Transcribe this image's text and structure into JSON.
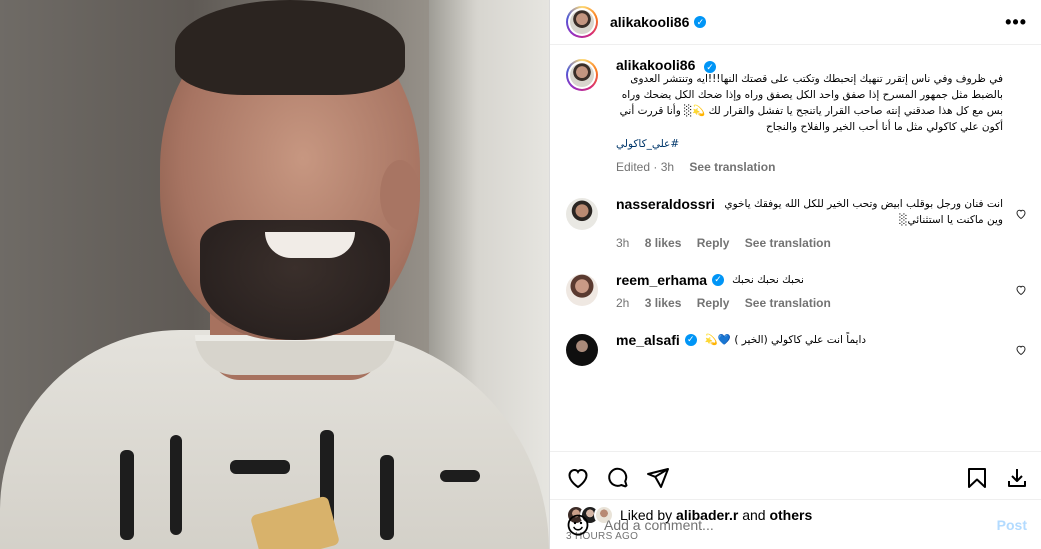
{
  "post": {
    "author": "alikakooli86",
    "more_icon": "•••"
  },
  "caption": {
    "author": "alikakooli86",
    "text": "في ظروف وفي ناس إتقرر تنهيك إتحبطك وتكتب على قصتك النها!!!ايه وتنتشر العدوى بالضبط مثل جمهور المسرح إذا صفق واحد الكل يصفق وراه وإذا ضحك الكل يضحك وراه بس مع كل هذا صدقني إنته صاحب القرار ياتنجح يا تفشل والقرار لك 💫░ وأنا قررت أني أكون علي كاكولي مثل ما أنا أحب الخير والفلاح والنجاح",
    "hashtag": "#علي_كاكولي",
    "edited": "Edited · 3h",
    "translate": "See translation"
  },
  "comments": [
    {
      "user": "nasseraldossri",
      "text": "انت فنان ورجل بوقلب ابيض وتحب الخير للكل الله يوفقك ياخوي وين ماكنت يا استثنائي░",
      "time": "3h",
      "likes": "8 likes",
      "reply": "Reply",
      "translate": "See translation"
    },
    {
      "user": "reem_erhama",
      "text": "نحبك نحبك نحبك",
      "time": "2h",
      "likes": "3 likes",
      "reply": "Reply",
      "translate": "See translation"
    },
    {
      "user": "me_alsafi",
      "text": "دايماً انت علي كاكولي (الخير ) 💙💫"
    }
  ],
  "likes": {
    "prefix": "Liked by",
    "user": "alibader.r",
    "and": "and",
    "others": "others"
  },
  "timestamp": "3 HOURS AGO",
  "composer": {
    "placeholder": "Add a comment...",
    "post": "Post"
  },
  "colors": {
    "accent": "#0095f6",
    "muted": "#737373",
    "hashtag": "#00376b",
    "post_disabled": "#b3dbff"
  }
}
